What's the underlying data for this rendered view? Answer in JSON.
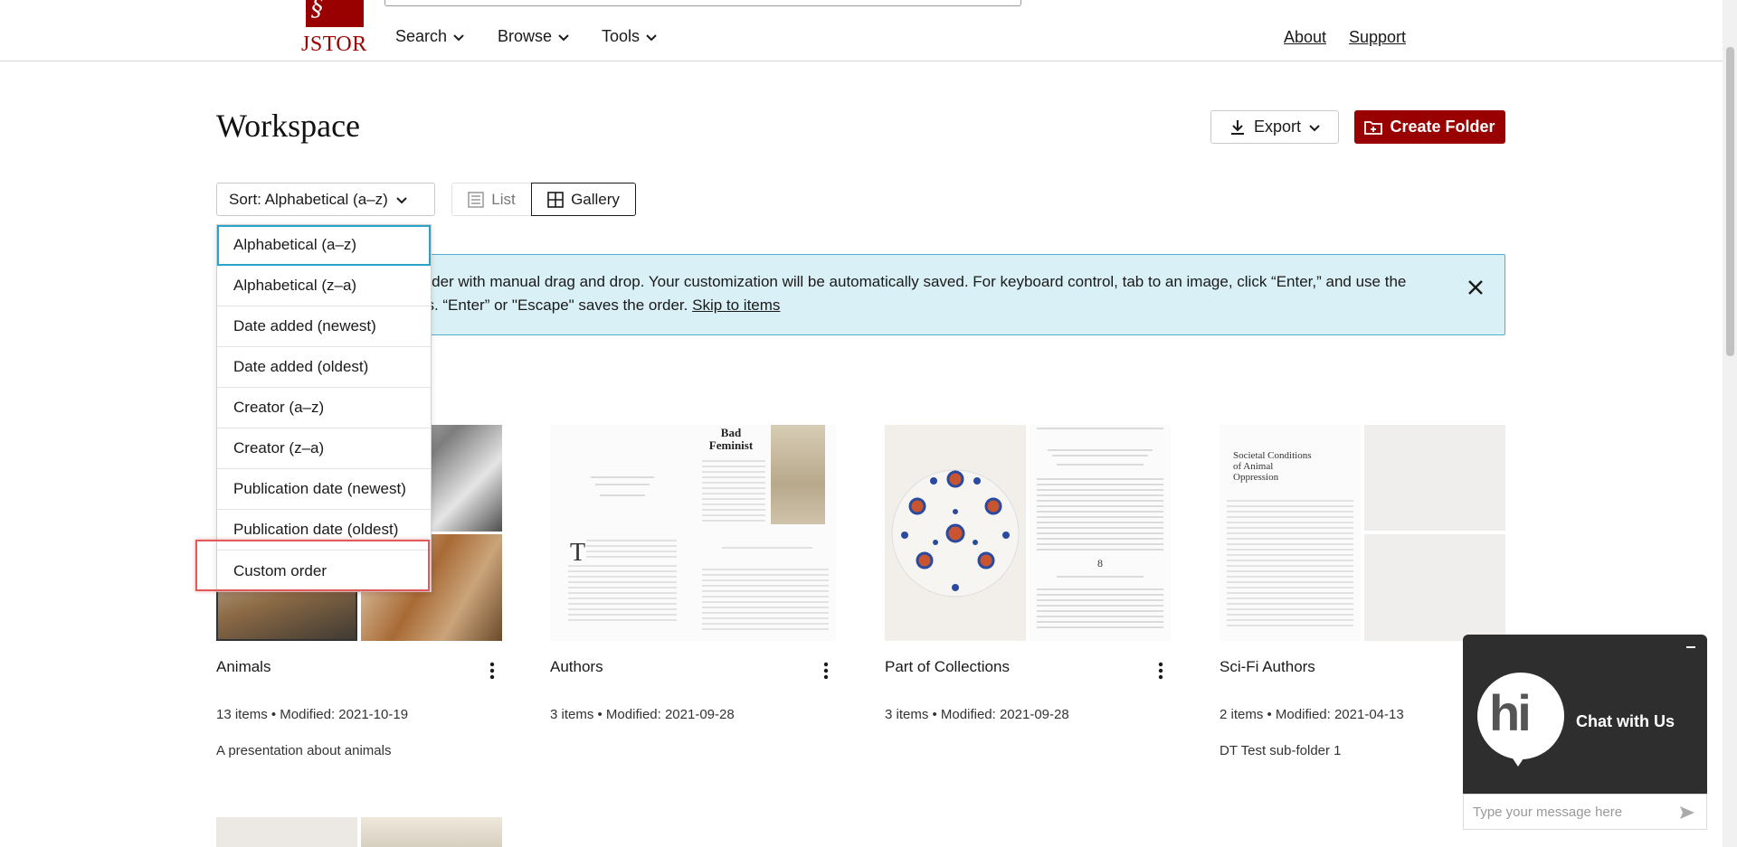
{
  "header": {
    "logo_text": "JSTOR",
    "nav": [
      {
        "label": "Search"
      },
      {
        "label": "Browse"
      },
      {
        "label": "Tools"
      }
    ],
    "links": [
      {
        "label": "About"
      },
      {
        "label": "Support"
      }
    ]
  },
  "page": {
    "title": "Workspace",
    "export_label": "Export",
    "create_folder_label": "Create Folder",
    "sort_label": "Sort: Alphabetical (a–z)",
    "view_list_label": "List",
    "view_gallery_label": "Gallery"
  },
  "banner": {
    "line1": "order with manual drag and drop. Your customization will be automatically saved. For keyboard control, tab to an image, click “Enter,” and use the",
    "line2_prefix": "ns. “Enter” or \"Escape\" saves the order. ",
    "skip_link": "Skip to items"
  },
  "sort_menu": {
    "options": [
      "Alphabetical (a–z)",
      "Alphabetical (z–a)",
      "Date added (newest)",
      "Date added (oldest)",
      "Creator (a–z)",
      "Creator (z–a)",
      "Publication date (newest)",
      "Publication date (oldest)",
      "Custom order"
    ],
    "selected": "Alphabetical (a–z)",
    "highlighted": "Custom order"
  },
  "cards": [
    {
      "title": "Animals",
      "meta": "13 items • Modified: 2021-10-19",
      "description": "A presentation about animals"
    },
    {
      "title": "Authors",
      "meta": "3 items • Modified: 2021-09-28",
      "description": ""
    },
    {
      "title": "Part of Collections",
      "meta": "3 items • Modified: 2021-09-28",
      "description": ""
    },
    {
      "title": "Sci-Fi Authors",
      "meta": "2 items • Modified: 2021-04-13",
      "description": "DT Test sub-folder 1"
    }
  ],
  "thumb_text": {
    "bad_feminist": "Bad Feminist",
    "page_number": "8",
    "societal_title": "Societal Conditions of Animal Oppression"
  },
  "chat": {
    "bubble_text": "hi",
    "label": "Chat with Us",
    "input_placeholder": "Type your message here"
  },
  "colors": {
    "brand": "#990000",
    "banner_bg": "#d9f1f6",
    "banner_border": "#4fb0c6",
    "highlight": "#e05a5a",
    "chat_bg": "#2e2e2e"
  }
}
